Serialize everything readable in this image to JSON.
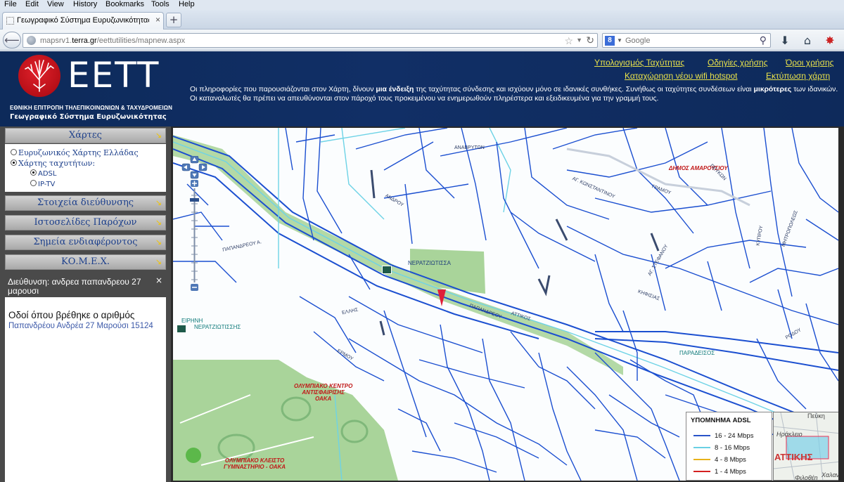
{
  "browser": {
    "menu": [
      "File",
      "Edit",
      "View",
      "History",
      "Bookmarks",
      "Tools",
      "Help"
    ],
    "tab_title": "Γεωγραφικό Σύστημα Ευρυζωνικότητας ΕΕ...",
    "new_tab": "+",
    "url_host_prefix": "mapsrv1.",
    "url_host_main": "terra.gr",
    "url_path": "/eettutilities/mapnew.aspx",
    "search_placeholder": "Google",
    "search_engine": "8"
  },
  "header": {
    "logo_text": "EETT",
    "org_name": "ΕΘΝΙΚΗ ΕΠΙΤΡΟΠΗ ΤΗΛΕΠΙΚΟΙΝΩΝΙΩΝ & ΤΑΧΥΔΡΟΜΕΙΩΝ",
    "system_name": "Γεωγραφικό Σύστημα Ευρυζωνικότητας",
    "links": {
      "speed_calc": "Υπολογισμός Ταχύτητας",
      "instructions": "Οδηγίες χρήσης",
      "terms": "Όροι χρήσης",
      "wifi": "Καταχώρηση νέου wifi hotspot",
      "print": "Εκτύπωση χάρτη"
    },
    "disclaimer_1": "Οι πληροφορίες που παρουσιάζονται στον Χάρτη, δίνουν ",
    "disclaimer_bold_1": "μια ένδειξη",
    "disclaimer_2": " της ταχύτητας σύνδεσης και ισχύουν μόνο σε ιδανικές συνθήκες. Συνήθως οι ταχύτητες συνδέσεων είναι ",
    "disclaimer_bold_2": "μικρότερες",
    "disclaimer_3": " των ιδανικών. Οι καταναλωτές θα πρέπει να απευθύνονται στον πάροχό τους προκειμένου να ενημερωθούν πληρέστερα και εξειδικευμένα για την γραμμή τους."
  },
  "sidebar": {
    "maps_header": "Χάρτες",
    "options": {
      "broadband_map": "Ευρυζωνικός Χάρτης Ελλάδας",
      "speed_map": "Χάρτης ταχυτήτων:",
      "adsl": "ADSL",
      "iptv": "IP-TV"
    },
    "sections": [
      "Στοιχεία διεύθυνσης",
      "Ιστοσελίδες Παρόχων",
      "Σημεία ενδιαφέροντος",
      "ΚΟ.Μ.Ε.Χ."
    ],
    "arrow": "↘",
    "address_panel": {
      "title": "Διεύθυνση: ανδρεα παπανδρεου 27 μαρουσι",
      "close": "×",
      "heading": "Οδοί όπου βρέθηκε ο αριθμός",
      "result": "Παπανδρέου Ανδρέα 27 Μαρούσι 15124"
    }
  },
  "map": {
    "places": {
      "amarousio": "ΔΗΜΟΣ ΑΜΑΡΟΥΣΙΟΥ",
      "paradeisos": "ΠΑΡΑΔΕΙΣΟΣ",
      "neratziotissa_station": "ΝΕΡΑΤΖΙΩΤΙΣΣΑ",
      "eirini": "ΕΙΡΗΝΗ",
      "neratziotissis": "ΝΕΡΑΤΖΙΩΤΙΣΣΗΣ",
      "oaka_center": "ΟΛΥΜΠΙΑΚΟ ΚΕΝΤΡΟ\nΑΝΤΙΣΦΑΙΡΙΣΗΣ\nΟΑΚΑ",
      "oaka_gym": "ΟΛΥΜΠΙΑΚΟ ΚΛΕΙΣΤΟ\nΓΥΜΝΑΣΤΗΡΙΟ - ΟΑΚΑ"
    },
    "streets": [
      "ΠΑΠΑΝΔΡΕΟΥ Α.",
      "ΑΓ. ΚΩΝΣΤΑΝΤΙΝΟΥ",
      "ΠΑΠΑΝΔΡΕΟΥ",
      "ΕΡΜΟΥ",
      "ΑΝΑΒΡΥΤΩΝ",
      "ΜΗΤΡΟΠΟΛΕΩΣ",
      "ΑΓ. ΣΤΕΦΑΝΟΥ",
      "ΑΝΔΡΟΥ",
      "ΚΗΦΙΣΙΑΣ",
      "ΠΕΥΚΩΝ",
      "ΚΥΠΡΟΥ",
      "ΑΤΤΙΚΟΣ",
      "ΕΛΛΗΣ",
      "ΓΡΑΜΟΥ",
      "ΡΟΔΟΥ"
    ],
    "legend": {
      "title": "ΥΠΟΜΝΗΜΑ ADSL",
      "items": [
        {
          "label": "16 - 24 Mbps",
          "color": "#2a54c8"
        },
        {
          "label": "8 - 16 Mbps",
          "color": "#6ad0e4"
        },
        {
          "label": "4 - 8 Mbps",
          "color": "#e8b21a"
        },
        {
          "label": "1 - 4 Mbps",
          "color": "#d42020"
        }
      ]
    },
    "overview": {
      "peuki": "Πεύκη",
      "irakleio": "Ηράκλειο",
      "attikis": "ΑΤΤΙΚΗΣ",
      "halandri": "Χαλαν",
      "filothei": "Φιλοθέη"
    }
  },
  "colors": {
    "street_fast": "#1b4fd0",
    "street_mid": "#6ed3e6",
    "park": "#a9d49a",
    "header_bg": "#0f2c5f",
    "link_yellow": "#e9e24a"
  }
}
